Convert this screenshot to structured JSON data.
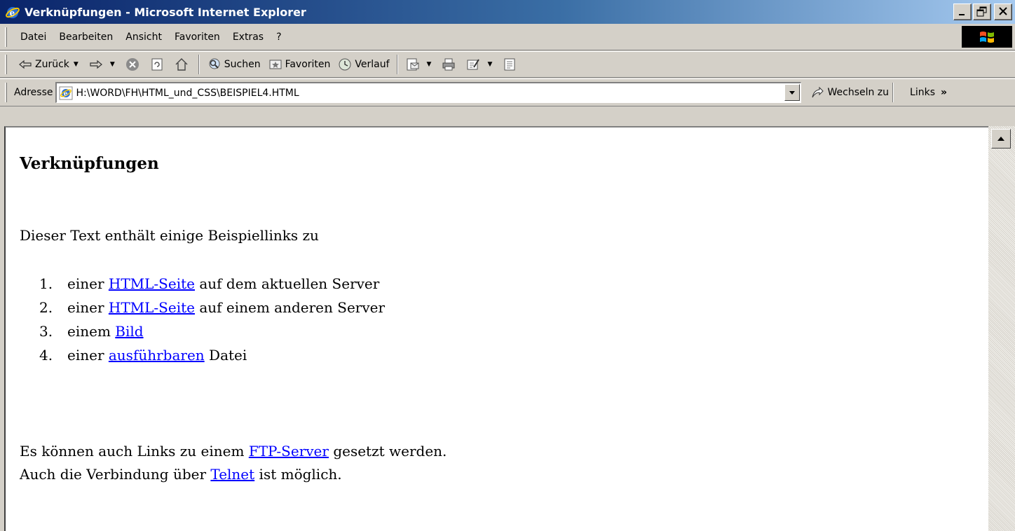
{
  "window": {
    "title": "Verknüpfungen - Microsoft Internet Explorer",
    "minimize_glyph": "_",
    "maximize_glyph": "□",
    "close_glyph": "×"
  },
  "menu": {
    "items": [
      "Datei",
      "Bearbeiten",
      "Ansicht",
      "Favoriten",
      "Extras",
      "?"
    ]
  },
  "toolbar": {
    "back_label": "Zurück",
    "search_label": "Suchen",
    "favorites_label": "Favoriten",
    "history_label": "Verlauf"
  },
  "address": {
    "label": "Adresse",
    "value": "H:\\WORD\\FH\\HTML_und_CSS\\BEISPIEL4.HTML",
    "go_label": "Wechseln zu",
    "links_label": "Links"
  },
  "page": {
    "heading": "Verknüpfungen",
    "intro": "Dieser Text enthält einige Beispiellinks zu",
    "list": [
      {
        "num": "1.",
        "before": "einer",
        "link": "HTML-Seite",
        "after": "auf dem aktuellen Server"
      },
      {
        "num": "2.",
        "before": "einer",
        "link": "HTML-Seite",
        "after": "auf einem anderen Server"
      },
      {
        "num": "3.",
        "before": "einem",
        "link": "Bild",
        "after": ""
      },
      {
        "num": "4.",
        "before": "einer",
        "link": "ausführbaren",
        "after": "Datei"
      }
    ],
    "line1_before": "Es können auch Links zu einem",
    "line1_link": "FTP-Server",
    "line1_after": "gesetzt werden.",
    "line2_before": "Auch die Verbindung über",
    "line2_link": "Telnet",
    "line2_after": "ist möglich."
  },
  "colors": {
    "link": "#0000ff",
    "titlebar_start": "#0a246a",
    "titlebar_end": "#a6caf0",
    "chrome": "#d4d0c8"
  },
  "icons": [
    "ie-logo-icon",
    "back-arrow-icon",
    "forward-arrow-icon",
    "stop-icon",
    "refresh-icon",
    "home-icon",
    "search-icon",
    "favorites-icon",
    "history-icon",
    "mail-icon",
    "print-icon",
    "edit-icon",
    "discuss-icon",
    "go-arrow-icon",
    "windows-logo-icon"
  ]
}
